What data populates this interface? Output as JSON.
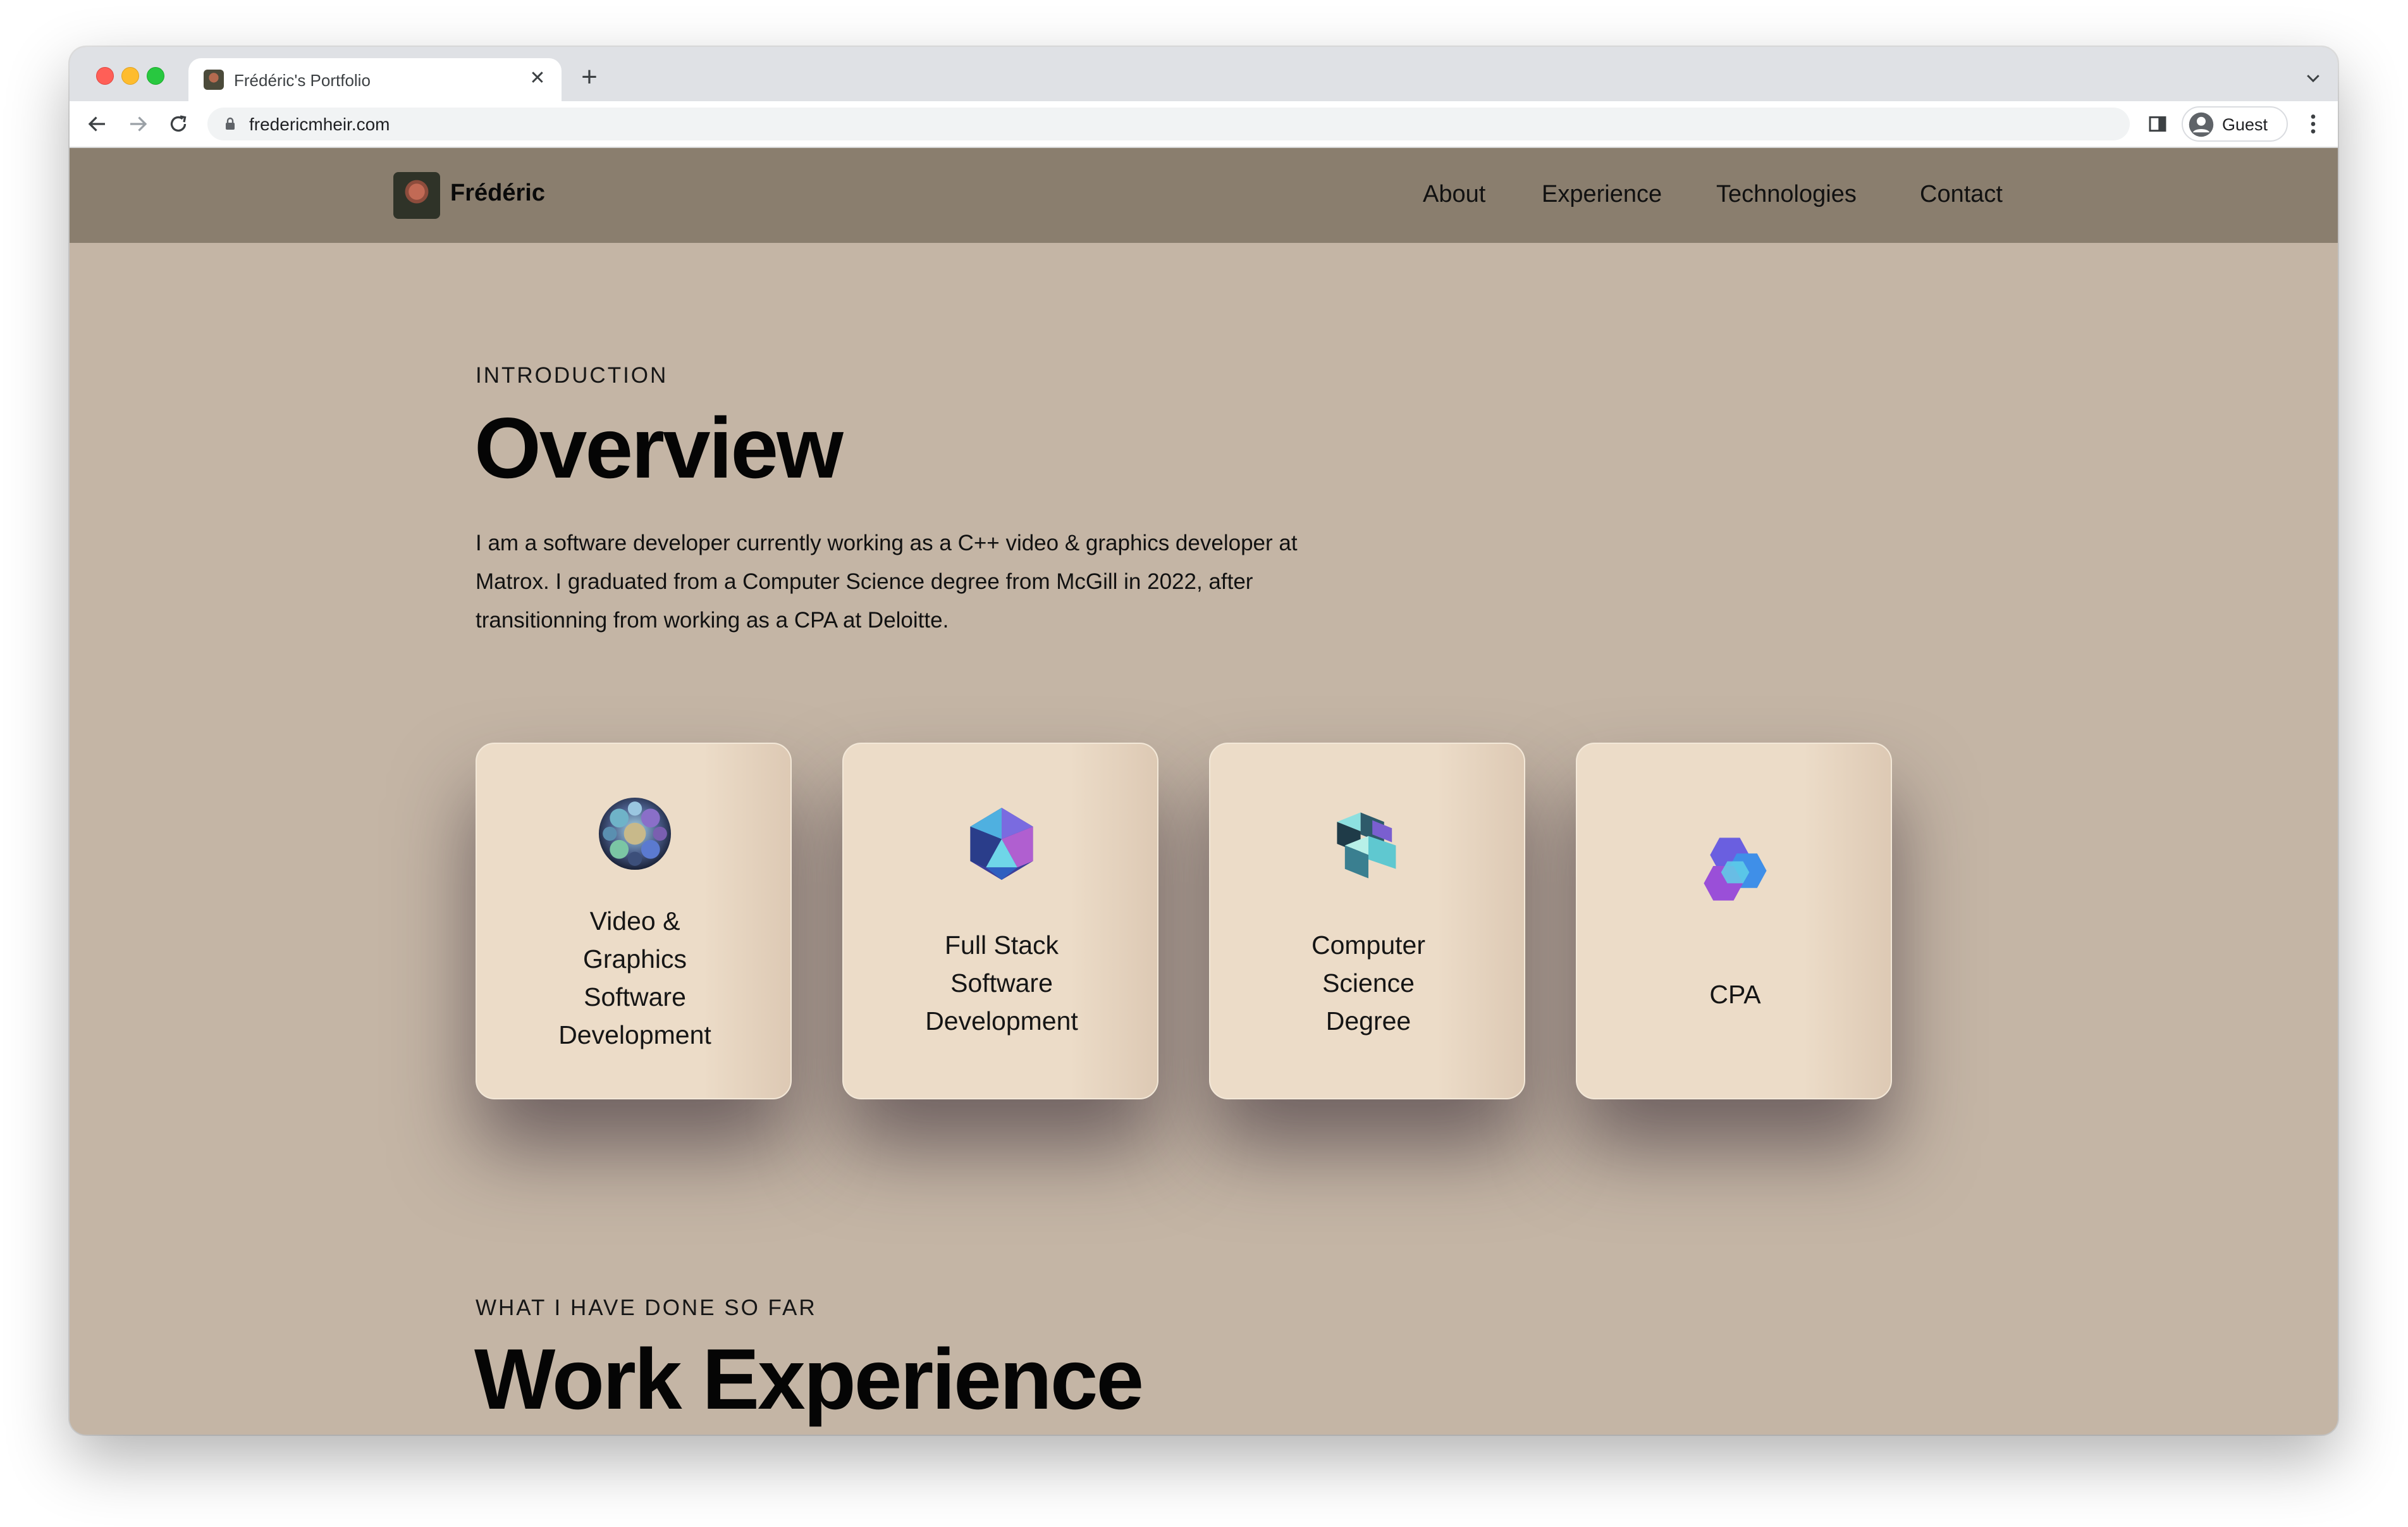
{
  "browser": {
    "tab_title": "Frédéric's Portfolio",
    "url": "fredericmheir.com",
    "profile_label": "Guest"
  },
  "site": {
    "logo_name": "Frédéric",
    "nav": [
      "About",
      "Experience",
      "Technologies",
      "Contact"
    ]
  },
  "overview": {
    "eyebrow": "INTRODUCTION",
    "title": "Overview",
    "paragraph_lines": [
      "I am a software developer currently working as a C++ video & graphics developer at",
      "Matrox. I graduated from a Computer Science degree from McGill in 2022, after",
      "transitionning from working as a CPA at Deloitte."
    ]
  },
  "services": [
    {
      "lines": [
        "Video &",
        "Graphics",
        "Software",
        "Development"
      ],
      "icon": "flower-sphere-icon"
    },
    {
      "lines": [
        "Full Stack",
        "Software",
        "Development"
      ],
      "icon": "crystal-gem-icon"
    },
    {
      "lines": [
        "Computer",
        "Science",
        "Degree"
      ],
      "icon": "cube-cluster-icon"
    },
    {
      "lines": [
        "CPA"
      ],
      "icon": "hex-puzzle-icon"
    }
  ],
  "experience": {
    "eyebrow": "WHAT I HAVE DONE SO FAR",
    "title": "Work Experience"
  },
  "colors": {
    "page_bg": "#c4b5a5",
    "nav_bg": "#8a7e6e",
    "card_bg": "#ecdcc8"
  }
}
